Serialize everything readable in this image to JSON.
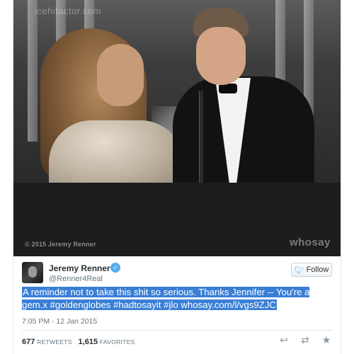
{
  "media": {
    "watermark_top": "icehitactor.com",
    "copyright": "© 2015 Jeremy Renner",
    "brand": "whosay"
  },
  "tweet": {
    "display_name": "Jeremy Renner",
    "handle": "@Renner4Real",
    "follow_label": "Follow",
    "text": "A reminder not to take this shit so serious.  Thanks Jennifer -- You're a gem.x  #goldenglobes #hadtosayit #jlo whosay.com/l/vgs9ZJC",
    "timestamp": "7:05 PM - 12 Jan 2015",
    "retweets_count": "677",
    "retweets_label": "RETWEETS",
    "favorites_count": "1,615",
    "favorites_label": "FAVORITES"
  },
  "icons": {
    "verified": "verified-badge-icon",
    "bird": "twitter-bird-icon",
    "reply": "reply-icon",
    "retweet": "retweet-icon",
    "favorite": "star-icon"
  },
  "colors": {
    "highlight": "#3a7fd6",
    "twitter_blue": "#55acee",
    "text_secondary": "#66757f"
  }
}
